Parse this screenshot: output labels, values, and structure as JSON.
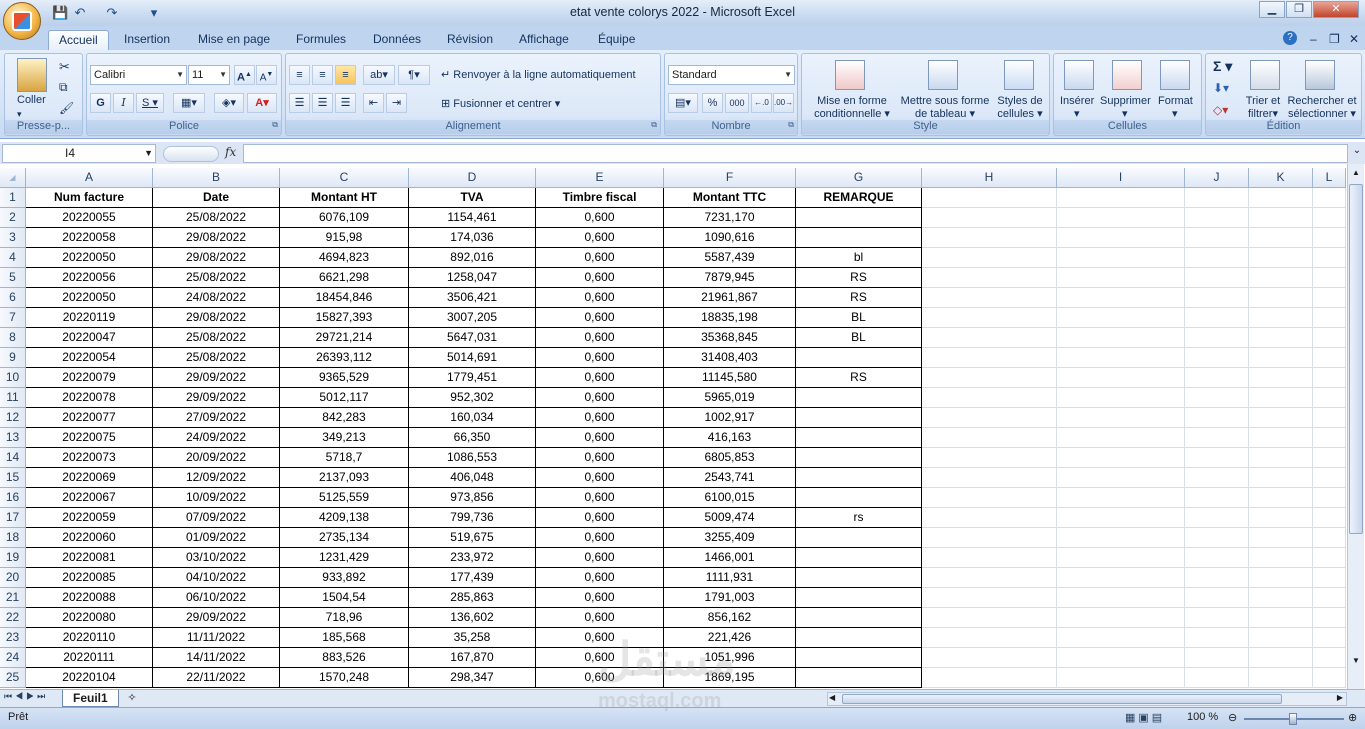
{
  "window": {
    "title": "etat vente colorys 2022 - Microsoft Excel",
    "min": "▁",
    "restore": "❐",
    "close": "✕"
  },
  "ribbon_tabs": [
    "Accueil",
    "Insertion",
    "Mise en page",
    "Formules",
    "Données",
    "Révision",
    "Affichage",
    "Équipe"
  ],
  "ribbon": {
    "coller": "Coller",
    "presse_papiers": "Presse-p...",
    "font_name": "Calibri",
    "font_size": "11",
    "police": "Police",
    "wrap_text": "Renvoyer à la ligne automatiquement",
    "merge_center": "Fusionner et centrer",
    "alignement": "Alignement",
    "number_format": "Standard",
    "nombre": "Nombre",
    "percent": "%",
    "thousands": "000",
    "cond_format": "Mise en forme conditionnelle",
    "format_table": "Mettre sous forme de tableau",
    "cell_styles": "Styles de cellules",
    "style": "Style",
    "insert": "Insérer",
    "delete": "Supprimer",
    "format": "Format",
    "cellules": "Cellules",
    "sort_filter": "Trier et filtrer",
    "find_select": "Rechercher et sélectionner",
    "edition": "Édition",
    "sigma": "Σ"
  },
  "namebox": "I4",
  "fx": "fx",
  "columns": [
    "A",
    "B",
    "C",
    "D",
    "E",
    "F",
    "G",
    "H",
    "I",
    "J",
    "K",
    "L"
  ],
  "header_row": [
    "Num facture",
    "Date",
    "Montant HT",
    "TVA",
    "Timbre fiscal",
    "Montant TTC",
    "REMARQUE"
  ],
  "rows": [
    [
      "20220055",
      "25/08/2022",
      "6076,109",
      "1154,461",
      "0,600",
      "7231,170",
      ""
    ],
    [
      "20220058",
      "29/08/2022",
      "915,98",
      "174,036",
      "0,600",
      "1090,616",
      ""
    ],
    [
      "20220050",
      "29/08/2022",
      "4694,823",
      "892,016",
      "0,600",
      "5587,439",
      "bl"
    ],
    [
      "20220056",
      "25/08/2022",
      "6621,298",
      "1258,047",
      "0,600",
      "7879,945",
      "RS"
    ],
    [
      "20220050",
      "24/08/2022",
      "18454,846",
      "3506,421",
      "0,600",
      "21961,867",
      "RS"
    ],
    [
      "20220119",
      "29/08/2022",
      "15827,393",
      "3007,205",
      "0,600",
      "18835,198",
      "BL"
    ],
    [
      "20220047",
      "25/08/2022",
      "29721,214",
      "5647,031",
      "0,600",
      "35368,845",
      "BL"
    ],
    [
      "20220054",
      "25/08/2022",
      "26393,112",
      "5014,691",
      "0,600",
      "31408,403",
      ""
    ],
    [
      "20220079",
      "29/09/2022",
      "9365,529",
      "1779,451",
      "0,600",
      "11145,580",
      "RS"
    ],
    [
      "20220078",
      "29/09/2022",
      "5012,117",
      "952,302",
      "0,600",
      "5965,019",
      ""
    ],
    [
      "20220077",
      "27/09/2022",
      "842,283",
      "160,034",
      "0,600",
      "1002,917",
      ""
    ],
    [
      "20220075",
      "24/09/2022",
      "349,213",
      "66,350",
      "0,600",
      "416,163",
      ""
    ],
    [
      "20220073",
      "20/09/2022",
      "5718,7",
      "1086,553",
      "0,600",
      "6805,853",
      ""
    ],
    [
      "20220069",
      "12/09/2022",
      "2137,093",
      "406,048",
      "0,600",
      "2543,741",
      ""
    ],
    [
      "20220067",
      "10/09/2022",
      "5125,559",
      "973,856",
      "0,600",
      "6100,015",
      ""
    ],
    [
      "20220059",
      "07/09/2022",
      "4209,138",
      "799,736",
      "0,600",
      "5009,474",
      "rs"
    ],
    [
      "20220060",
      "01/09/2022",
      "2735,134",
      "519,675",
      "0,600",
      "3255,409",
      ""
    ],
    [
      "20220081",
      "03/10/2022",
      "1231,429",
      "233,972",
      "0,600",
      "1466,001",
      ""
    ],
    [
      "20220085",
      "04/10/2022",
      "933,892",
      "177,439",
      "0,600",
      "1111,931",
      ""
    ],
    [
      "20220088",
      "06/10/2022",
      "1504,54",
      "285,863",
      "0,600",
      "1791,003",
      ""
    ],
    [
      "20220080",
      "29/09/2022",
      "718,96",
      "136,602",
      "0,600",
      "856,162",
      ""
    ],
    [
      "20220110",
      "11/11/2022",
      "185,568",
      "35,258",
      "0,600",
      "221,426",
      ""
    ],
    [
      "20220111",
      "14/11/2022",
      "883,526",
      "167,870",
      "0,600",
      "1051,996",
      ""
    ],
    [
      "20220104",
      "22/11/2022",
      "1570,248",
      "298,347",
      "0,600",
      "1869,195",
      ""
    ]
  ],
  "sheet_tab": "Feuil1",
  "status": {
    "ready": "Prêt",
    "zoom": "100 %"
  },
  "watermark": "مستقل",
  "watermark2": "mostaql.com"
}
